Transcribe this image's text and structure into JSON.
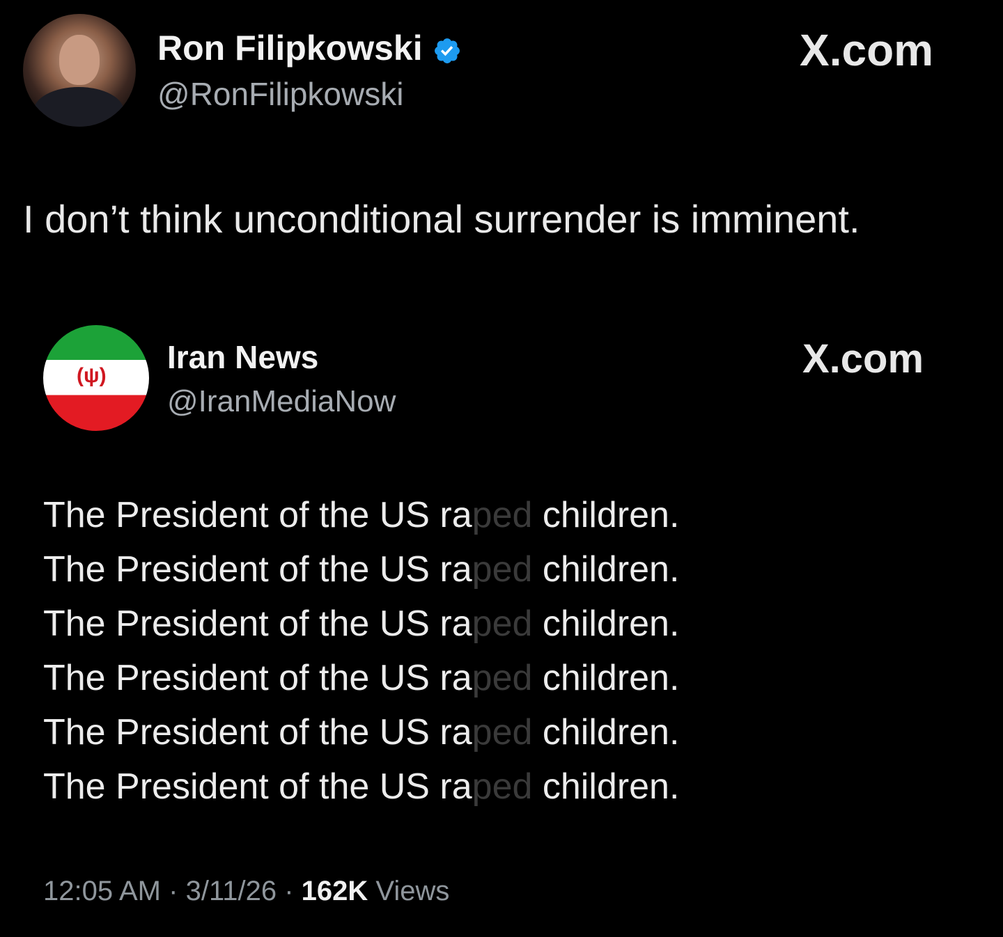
{
  "tweet": {
    "author_name": "Ron Filipkowski",
    "author_handle": "@RonFilipkowski",
    "source_label": "X.com",
    "text": "I don’t think unconditional surrender is imminent.",
    "verified_icon": "verified-badge-icon"
  },
  "quoted": {
    "author_name": "Iran News",
    "author_handle": "@IranMediaNow",
    "source_label": "X.com",
    "lines": [
      {
        "before": "The President of the US ra",
        "faded": "ped",
        "after": " children."
      },
      {
        "before": "The President of the US ra",
        "faded": "ped",
        "after": " children."
      },
      {
        "before": "The President of the US ra",
        "faded": "ped",
        "after": " children."
      },
      {
        "before": "The President of the US ra",
        "faded": "ped",
        "after": " children."
      },
      {
        "before": "The President of the US ra",
        "faded": "ped",
        "after": " children."
      },
      {
        "before": "The President of the US ra",
        "faded": "ped",
        "after": " children."
      }
    ],
    "time": "12:05 AM",
    "date": "3/11/26",
    "views_count": "162K",
    "views_label": "Views",
    "separator": "·"
  },
  "colors": {
    "background": "#000000",
    "verified": "#1d9bf0",
    "flag_green": "#1ca238",
    "flag_red": "#e31b23"
  }
}
